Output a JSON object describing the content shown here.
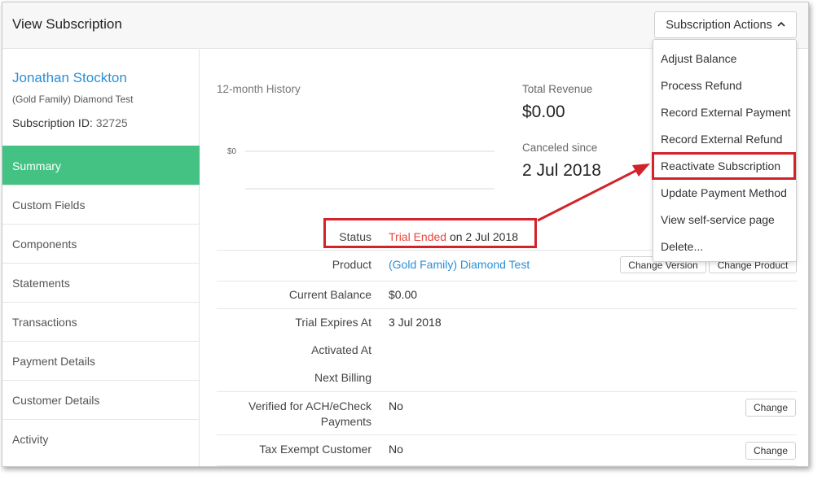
{
  "header": {
    "title": "View Subscription",
    "actions_label": "Subscription Actions",
    "actions_icon": "chevron-up-icon"
  },
  "customer": {
    "name": "Jonathan Stockton",
    "plan": "(Gold Family) Diamond Test",
    "sub_id_label": "Subscription ID:",
    "sub_id_value": "32725"
  },
  "nav": {
    "items": [
      {
        "label": "Summary"
      },
      {
        "label": "Custom Fields"
      },
      {
        "label": "Components"
      },
      {
        "label": "Statements"
      },
      {
        "label": "Transactions"
      },
      {
        "label": "Payment Details"
      },
      {
        "label": "Customer Details"
      },
      {
        "label": "Activity"
      }
    ],
    "active_index": 0
  },
  "summary": {
    "history_label": "12-month History",
    "chart_tick": "$0",
    "total_revenue_label": "Total Revenue",
    "total_revenue_value": "$0.00",
    "canceled_label": "Canceled since",
    "canceled_value": "2 Jul 2018"
  },
  "details": {
    "status_label": "Status",
    "status_value": "Trial Ended",
    "status_suffix": " on 2 Jul 2018",
    "product_label": "Product",
    "product_value": "(Gold Family) Diamond Test",
    "change_version_label": "Change Version",
    "change_product_label": "Change Product",
    "current_balance_label": "Current Balance",
    "current_balance_value": "$0.00",
    "trial_expires_label": "Trial Expires At",
    "trial_expires_value": "3 Jul 2018",
    "activated_label": "Activated At",
    "activated_value": "",
    "next_billing_label": "Next Billing",
    "next_billing_value": "",
    "ach_label_1": "Verified for ACH/eCheck",
    "ach_label_2": "Payments",
    "ach_value": "No",
    "tax_label": "Tax Exempt Customer",
    "tax_value": "No",
    "change_label": "Change"
  },
  "menu": {
    "items": [
      "Adjust Balance",
      "Process Refund",
      "Record External Payment",
      "Record External Refund",
      "Reactivate Subscription",
      "Update Payment Method",
      "View self-service page",
      "Delete..."
    ]
  },
  "colors": {
    "accent_green": "#44c283",
    "link_blue": "#2b8fd6",
    "annotation_red": "#d2232a",
    "status_red": "#e8453c"
  }
}
